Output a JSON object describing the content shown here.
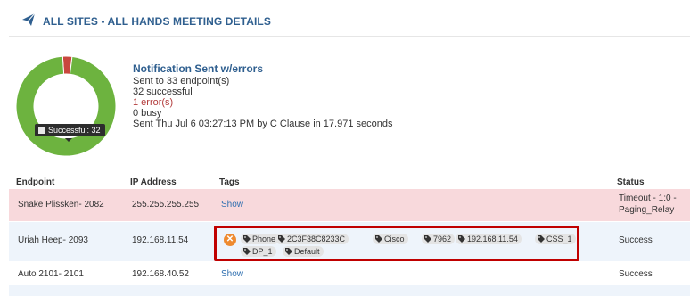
{
  "header": {
    "title": "ALL SITES - ALL HANDS MEETING DETAILS",
    "icon": "paper-plane-icon"
  },
  "colors": {
    "success": "#6db33f",
    "error": "#c9473e",
    "accent": "#2f5f8f",
    "highlight_border": "#c00000"
  },
  "chart_data": {
    "type": "pie",
    "donut": true,
    "categories": [
      "Successful",
      "Error"
    ],
    "values": [
      32,
      1
    ],
    "tooltip": "Successful: 32"
  },
  "summary": {
    "heading": "Notification Sent w/errors",
    "sent_to": "Sent to 33 endpoint(s)",
    "successful": "32 successful",
    "errors": "1 error(s)",
    "busy": "0 busy",
    "sent_info": "Sent Thu Jul 6 03:27:13 PM by C Clause in 17.971 seconds"
  },
  "table": {
    "headers": {
      "endpoint": "Endpoint",
      "ip": "IP Address",
      "tags": "Tags",
      "status": "Status"
    },
    "rows": [
      {
        "endpoint": "Snake Plissken- 2082",
        "ip": "255.255.255.255",
        "tags_link": "Show",
        "status_line1": "Timeout - 1:0 -",
        "status_line2": "Paging_Relay"
      },
      {
        "endpoint": "Uriah Heep- 2093",
        "ip": "192.168.11.54",
        "tags": [
          "Phone",
          "2C3F38C8233C",
          "Cisco",
          "7962",
          "192.168.11.54",
          "CSS_1",
          "DP_1",
          "Default"
        ],
        "status": "Success"
      },
      {
        "endpoint": "Auto 2101- 2101",
        "ip": "192.168.40.52",
        "tags_link": "Show",
        "status": "Success"
      }
    ]
  }
}
